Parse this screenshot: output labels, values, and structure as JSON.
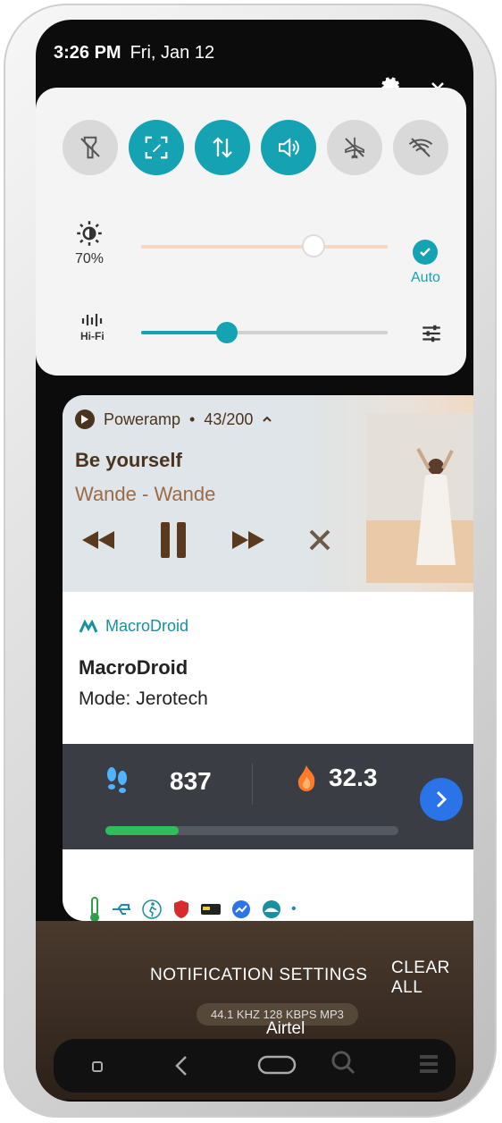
{
  "status_bar": {
    "time": "3:26 PM",
    "date": "Fri, Jan 12"
  },
  "quick_settings": {
    "toggles": [
      {
        "name": "flashlight",
        "icon": "flashlight-off-icon",
        "state": "off"
      },
      {
        "name": "screen-capture",
        "icon": "screenshot-edit-icon",
        "state": "on"
      },
      {
        "name": "mobile-data",
        "icon": "data-arrows-icon",
        "state": "on"
      },
      {
        "name": "sound",
        "icon": "speaker-icon",
        "state": "on"
      },
      {
        "name": "airplane-mode",
        "icon": "airplane-off-icon",
        "state": "off"
      },
      {
        "name": "wifi",
        "icon": "wifi-off-icon",
        "state": "off"
      }
    ],
    "brightness": {
      "label": "70%",
      "level": 0.7,
      "auto_label": "Auto"
    },
    "volume": {
      "label": "Hi-Fi",
      "level": 0.35
    }
  },
  "media": {
    "app": "Poweramp",
    "track_info": "43/200",
    "title": "Be yourself",
    "artist": "Wande - Wande"
  },
  "macrodroid": {
    "app": "MacroDroid",
    "title": "MacroDroid",
    "mode": "Mode: Jerotech"
  },
  "fitness": {
    "steps": "837",
    "calories": "32.3",
    "progress": 0.25
  },
  "footer": {
    "notification_settings": "NOTIFICATION SETTINGS",
    "clear_all": "CLEAR ALL",
    "audio_meta": "44.1 KHZ 128 KBPS MP3",
    "carrier": "Airtel"
  },
  "colors": {
    "accent": "#15a3b4",
    "media_text": "#4a3420",
    "fitness_bg": "#3a3d44"
  }
}
